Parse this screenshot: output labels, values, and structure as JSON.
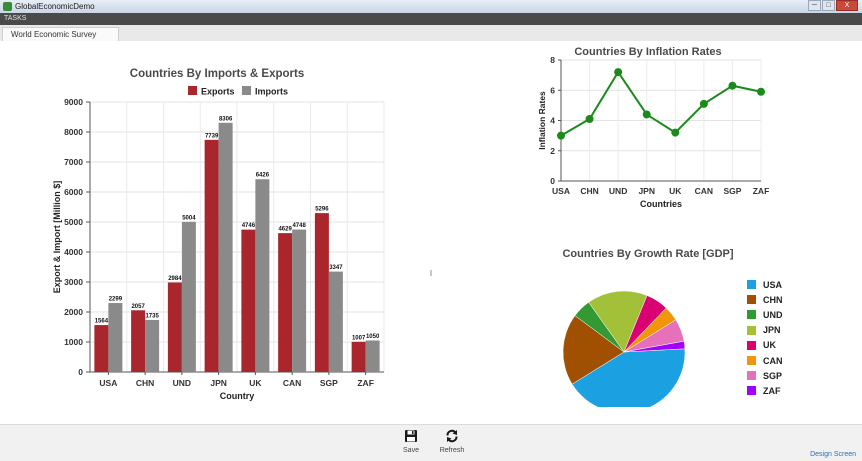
{
  "window": {
    "title": "GlobalEconomicDemo",
    "min": "─",
    "max": "□",
    "close": "X"
  },
  "tasks_label": "TASKS",
  "tab": {
    "label": "World Economic Survey"
  },
  "toolbar": {
    "save_label": "Save",
    "refresh_label": "Refresh",
    "design_link": "Design Screen"
  },
  "colors": {
    "exports": "#a8262c",
    "imports": "#8a8a8a",
    "inflation_line": "#1a8a1a"
  },
  "chart_data": [
    {
      "type": "bar",
      "title": "Countries By Imports & Exports",
      "xlabel": "Country",
      "ylabel": "Export & Import [Million $]",
      "categories": [
        "USA",
        "CHN",
        "UND",
        "JPN",
        "UK",
        "CAN",
        "SGP",
        "ZAF"
      ],
      "series": [
        {
          "name": "Exports",
          "values": [
            1564,
            2057,
            2984,
            7739,
            4746,
            4629,
            5296,
            1007
          ]
        },
        {
          "name": "Imports",
          "values": [
            2299,
            1735,
            5004,
            8306,
            6426,
            4748,
            3347,
            1050
          ]
        }
      ],
      "ylim": [
        0,
        9000
      ],
      "yticks": [
        0,
        1000,
        2000,
        3000,
        4000,
        5000,
        6000,
        7000,
        8000,
        9000
      ],
      "legend": "top",
      "grid": true
    },
    {
      "type": "line",
      "title": "Countries By Inflation Rates",
      "xlabel": "Countries",
      "ylabel": "Inflation Rates",
      "categories": [
        "USA",
        "CHN",
        "UND",
        "JPN",
        "UK",
        "CAN",
        "SGP",
        "ZAF"
      ],
      "values": [
        3.0,
        4.1,
        7.2,
        4.4,
        3.2,
        5.1,
        6.3,
        5.9
      ],
      "ylim": [
        0,
        8
      ],
      "yticks": [
        0,
        2,
        4,
        6,
        8
      ],
      "grid": true
    },
    {
      "type": "pie",
      "title": "Countries By Growth Rate [GDP]",
      "labels": [
        "USA",
        "CHN",
        "UND",
        "JPN",
        "UK",
        "CAN",
        "SGP",
        "ZAF"
      ],
      "values": [
        42,
        19,
        5,
        16,
        6,
        4,
        6,
        2
      ],
      "colors": [
        "#1ba1e2",
        "#a05000",
        "#339933",
        "#a2c139",
        "#d80073",
        "#f09609",
        "#e671b8",
        "#a200ff"
      ],
      "legend": "right"
    }
  ]
}
